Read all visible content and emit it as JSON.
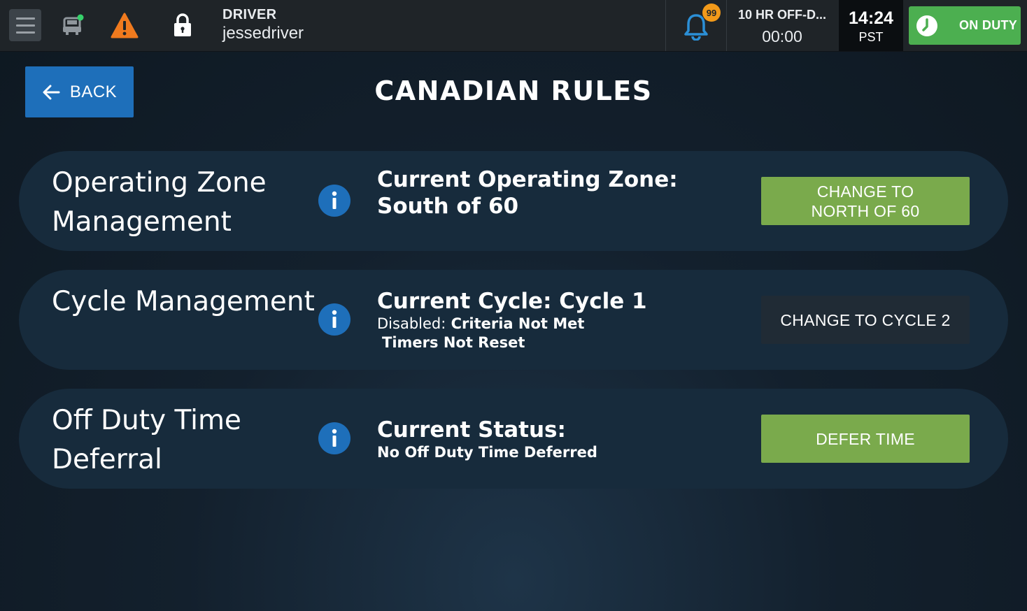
{
  "topbar": {
    "driver_label": "DRIVER",
    "driver_name": "jessedriver",
    "notification_count": "99",
    "offduty_label": "10 HR OFF-D...",
    "offduty_time": "00:00",
    "clock_time": "14:24",
    "clock_tz": "PST",
    "duty_status": "ON DUTY",
    "icons": [
      "menu-icon",
      "truck-icon",
      "warning-icon",
      "lock-icon",
      "bell-icon",
      "clock-icon"
    ]
  },
  "header": {
    "back_label": "BACK",
    "title": "CANADIAN RULES"
  },
  "cards": [
    {
      "title": "Operating Zone Management",
      "status_line1": "Current Operating Zone:",
      "status_line2": "South of 60",
      "button_label": "CHANGE TO NORTH OF 60",
      "button_enabled": true
    },
    {
      "title": "Cycle Management",
      "status_line1": "Current Cycle: Cycle 1",
      "disabled_prefix": "Disabled:",
      "disabled_reason1": "Criteria Not Met",
      "disabled_reason2": "Timers Not Reset",
      "button_label": "CHANGE TO CYCLE 2",
      "button_enabled": false
    },
    {
      "title": "Off Duty Time Deferral",
      "status_line1": "Current Status:",
      "status_line2": "No Off Duty Time Deferred",
      "button_label": "DEFER TIME",
      "button_enabled": true
    }
  ],
  "colors": {
    "topbar_bg": "#1f2428",
    "on_duty_green": "#4caf50",
    "action_green": "#7aaa4c",
    "back_blue": "#1e6fba",
    "info_blue": "#1e6fba",
    "warning_orange": "#f07a1e",
    "badge_orange": "#f29a1a",
    "card_bg": "#172b3c"
  }
}
